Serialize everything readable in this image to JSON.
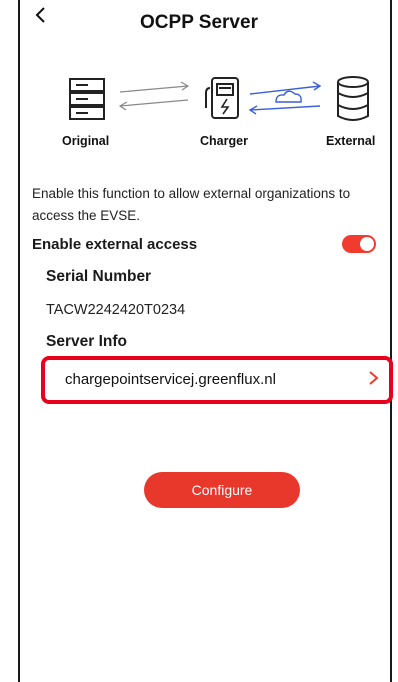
{
  "header": {
    "title": "OCPP Server",
    "back_icon": "chevron-left-icon"
  },
  "diagram": {
    "original_label": "Original",
    "charger_label": "Charger",
    "external_label": "External",
    "accent_color": "#3a5fd9"
  },
  "content": {
    "description": "Enable this function to allow external organizations to access the EVSE.",
    "enable_label": "Enable external access",
    "enable_on": true,
    "serial_label": "Serial Number",
    "serial_value": "TACW2242420T0234",
    "server_label": "Server Info",
    "server_value": "chargepointservicej.greenflux.nl",
    "highlight_color": "#e8001c"
  },
  "actions": {
    "configure_label": "Configure",
    "button_color": "#e8382b"
  }
}
